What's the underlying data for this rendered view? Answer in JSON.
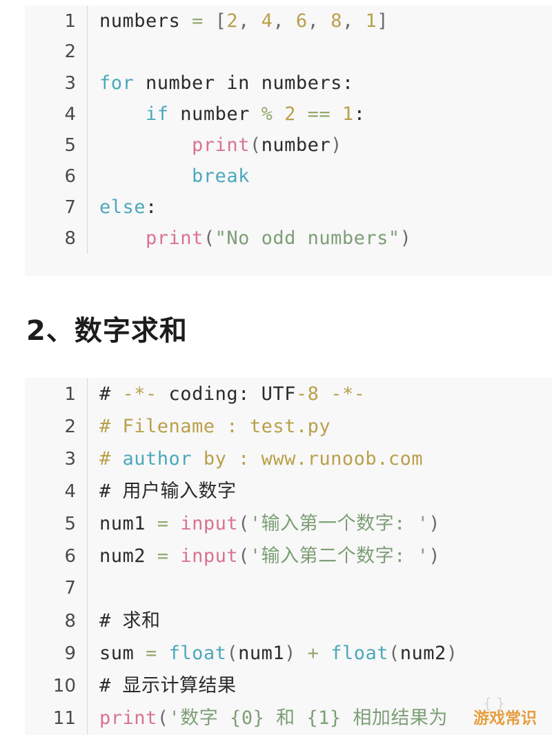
{
  "page": {
    "background": "#ffffff"
  },
  "colors": {
    "code_background": "#f8f8f8",
    "keyword": "#4ba8bc",
    "function": "#d9738f",
    "number": "#b9a04a",
    "string": "#7d9e76",
    "operator": "#93a86a",
    "comment": "#b9a04a",
    "plain": "#2b2b2b",
    "line_number": "#4a4a4a",
    "watermark": "#e6962f"
  },
  "code_block_1": {
    "language": "python",
    "lines": [
      {
        "number": "1",
        "tokens": [
          {
            "t": "numbers ",
            "c": "plain"
          },
          {
            "t": "=",
            "c": "operator"
          },
          {
            "t": " ",
            "c": "plain"
          },
          {
            "t": "[",
            "c": "punct"
          },
          {
            "t": "2",
            "c": "number"
          },
          {
            "t": ", ",
            "c": "punct"
          },
          {
            "t": "4",
            "c": "number"
          },
          {
            "t": ", ",
            "c": "punct"
          },
          {
            "t": "6",
            "c": "number"
          },
          {
            "t": ", ",
            "c": "punct"
          },
          {
            "t": "8",
            "c": "number"
          },
          {
            "t": ", ",
            "c": "punct"
          },
          {
            "t": "1",
            "c": "number"
          },
          {
            "t": "]",
            "c": "punct"
          }
        ]
      },
      {
        "number": "2",
        "tokens": []
      },
      {
        "number": "3",
        "tokens": [
          {
            "t": "for",
            "c": "keyword"
          },
          {
            "t": " number ",
            "c": "plain"
          },
          {
            "t": "in",
            "c": "plain"
          },
          {
            "t": " numbers:",
            "c": "plain"
          }
        ]
      },
      {
        "number": "4",
        "tokens": [
          {
            "t": "    ",
            "c": "plain"
          },
          {
            "t": "if",
            "c": "keyword"
          },
          {
            "t": " number ",
            "c": "plain"
          },
          {
            "t": "%",
            "c": "operator"
          },
          {
            "t": " ",
            "c": "plain"
          },
          {
            "t": "2",
            "c": "number"
          },
          {
            "t": " ",
            "c": "plain"
          },
          {
            "t": "==",
            "c": "operator"
          },
          {
            "t": " ",
            "c": "plain"
          },
          {
            "t": "1",
            "c": "number"
          },
          {
            "t": ":",
            "c": "plain"
          }
        ]
      },
      {
        "number": "5",
        "tokens": [
          {
            "t": "        ",
            "c": "plain"
          },
          {
            "t": "print",
            "c": "function"
          },
          {
            "t": "(",
            "c": "punct"
          },
          {
            "t": "number",
            "c": "plain"
          },
          {
            "t": ")",
            "c": "punct"
          }
        ]
      },
      {
        "number": "6",
        "tokens": [
          {
            "t": "        ",
            "c": "plain"
          },
          {
            "t": "break",
            "c": "keyword"
          }
        ]
      },
      {
        "number": "7",
        "tokens": [
          {
            "t": "else",
            "c": "keyword"
          },
          {
            "t": ":",
            "c": "plain"
          }
        ]
      },
      {
        "number": "8",
        "tokens": [
          {
            "t": "    ",
            "c": "plain"
          },
          {
            "t": "print",
            "c": "function"
          },
          {
            "t": "(",
            "c": "punct"
          },
          {
            "t": "\"No odd numbers\"",
            "c": "string"
          },
          {
            "t": ")",
            "c": "punct"
          }
        ]
      }
    ]
  },
  "heading": {
    "text": "2、数字求和"
  },
  "code_block_2": {
    "language": "python",
    "lines": [
      {
        "number": "1",
        "tokens": [
          {
            "t": "# ",
            "c": "plain"
          },
          {
            "t": "-*-",
            "c": "comment"
          },
          {
            "t": " coding",
            "c": "plain"
          },
          {
            "t": ":",
            "c": "plain"
          },
          {
            "t": " UTF",
            "c": "plain"
          },
          {
            "t": "-8",
            "c": "comment"
          },
          {
            "t": " ",
            "c": "plain"
          },
          {
            "t": "-*-",
            "c": "comment"
          }
        ]
      },
      {
        "number": "2",
        "tokens": [
          {
            "t": "# Filename : test.py",
            "c": "comment"
          }
        ]
      },
      {
        "number": "3",
        "tokens": [
          {
            "t": "# ",
            "c": "comment"
          },
          {
            "t": "author",
            "c": "keyword"
          },
          {
            "t": " by : www.runoob.com",
            "c": "comment"
          }
        ]
      },
      {
        "number": "4",
        "tokens": [
          {
            "t": "# 用户输入数字",
            "c": "plain"
          }
        ]
      },
      {
        "number": "5",
        "tokens": [
          {
            "t": "num1 ",
            "c": "plain"
          },
          {
            "t": "=",
            "c": "operator"
          },
          {
            "t": " ",
            "c": "plain"
          },
          {
            "t": "input",
            "c": "function"
          },
          {
            "t": "(",
            "c": "punct"
          },
          {
            "t": "'输入第一个数字: '",
            "c": "string"
          },
          {
            "t": ")",
            "c": "punct"
          }
        ]
      },
      {
        "number": "6",
        "tokens": [
          {
            "t": "num2 ",
            "c": "plain"
          },
          {
            "t": "=",
            "c": "operator"
          },
          {
            "t": " ",
            "c": "plain"
          },
          {
            "t": "input",
            "c": "function"
          },
          {
            "t": "(",
            "c": "punct"
          },
          {
            "t": "'输入第二个数字: '",
            "c": "string"
          },
          {
            "t": ")",
            "c": "punct"
          }
        ]
      },
      {
        "number": "7",
        "tokens": []
      },
      {
        "number": "8",
        "tokens": [
          {
            "t": "# 求和",
            "c": "plain"
          }
        ]
      },
      {
        "number": "9",
        "tokens": [
          {
            "t": "sum ",
            "c": "plain"
          },
          {
            "t": "=",
            "c": "operator"
          },
          {
            "t": " ",
            "c": "plain"
          },
          {
            "t": "float",
            "c": "keyword"
          },
          {
            "t": "(",
            "c": "punct"
          },
          {
            "t": "num1",
            "c": "plain"
          },
          {
            "t": ")",
            "c": "punct"
          },
          {
            "t": " ",
            "c": "plain"
          },
          {
            "t": "+",
            "c": "operator"
          },
          {
            "t": " ",
            "c": "plain"
          },
          {
            "t": "float",
            "c": "keyword"
          },
          {
            "t": "(",
            "c": "punct"
          },
          {
            "t": "num2",
            "c": "plain"
          },
          {
            "t": ")",
            "c": "punct"
          }
        ]
      },
      {
        "number": "10",
        "tokens": [
          {
            "t": "# 显示计算结果",
            "c": "plain"
          }
        ]
      },
      {
        "number": "11",
        "tokens": [
          {
            "t": "print",
            "c": "function"
          },
          {
            "t": "(",
            "c": "punct"
          },
          {
            "t": "'数字 {0} 和 {1} 相加结果为",
            "c": "string"
          }
        ]
      }
    ]
  },
  "watermark": {
    "text": "游戏常识",
    "mark": "{ }"
  }
}
